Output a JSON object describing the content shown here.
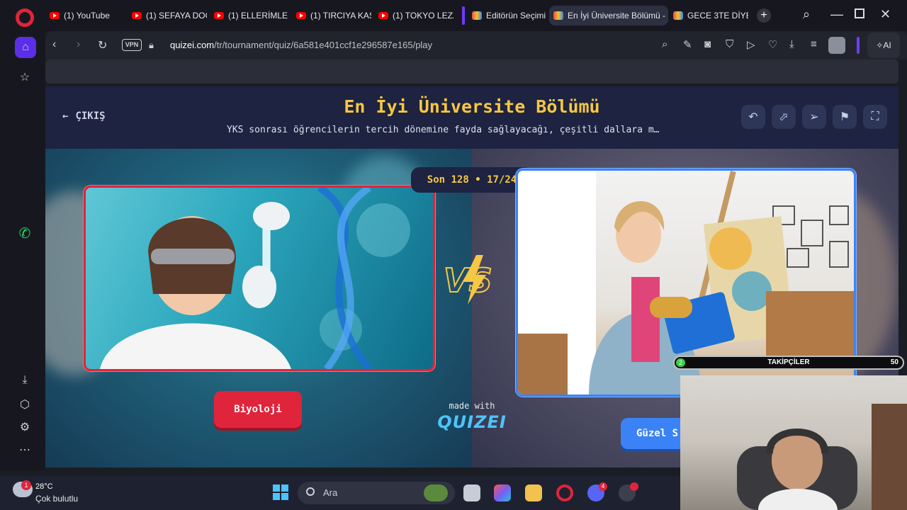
{
  "browser": {
    "tabs": [
      {
        "label": "(1) YouTube",
        "icon": "youtube-icon"
      },
      {
        "label": "(1) SEFAYA DOĞ",
        "icon": "youtube-icon"
      },
      {
        "label": "(1) ELLERİMLE PE",
        "icon": "youtube-icon"
      },
      {
        "label": "(1) TIRCIYA KASK",
        "icon": "youtube-icon"
      },
      {
        "label": "(1) TOKYO LEZZ",
        "icon": "youtube-icon"
      },
      {
        "label": "Editörün Seçimi",
        "icon": "quizei-icon"
      },
      {
        "label": "En İyi Üniversite Bölümü -",
        "icon": "quizei-icon"
      },
      {
        "label": "GECE 3TE DİYET",
        "icon": "quizei-icon"
      }
    ],
    "vpn_label": "VPN",
    "url_host": "quizei.com",
    "url_path": "/tr/tournament/quiz/6a581e401ccf1e296587e165/play",
    "ai_label": "AI"
  },
  "page": {
    "exit_label": "ÇIKIŞ",
    "title": "En İyi Üniversite Bölümü",
    "subtitle": "YKS sonrası öğrencilerin tercih dönemine fayda sağlayacağı, çeşitli dallara m…",
    "round_badge": "Son 128 • 17/24",
    "vs_label": "VS",
    "left_option": "Biyoloji",
    "right_option": "Güzel S",
    "made_with": "made with",
    "brand": "QUIZEI",
    "accent_colors": {
      "title": "#f6c744",
      "left": "#e0243b",
      "right": "#3b82f6"
    }
  },
  "overlay": {
    "followers_label": "TAKİPÇİLER",
    "followers_current": "2",
    "followers_goal": "50",
    "followers_progress": 0.04
  },
  "taskbar": {
    "temperature": "28°C",
    "condition": "Çok bulutlu",
    "weather_badge": "1",
    "search_placeholder": "Ara",
    "discord_badge": "4"
  }
}
